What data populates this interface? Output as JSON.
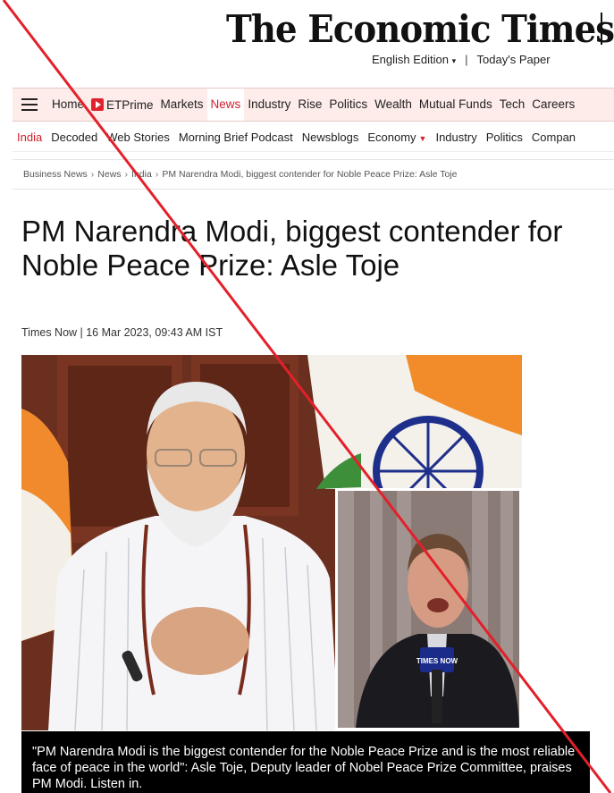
{
  "masthead": {
    "logo": "The Economic Times",
    "edition": "English Edition",
    "todays_paper": "Today's Paper"
  },
  "primary_nav": {
    "items": [
      "Home",
      "ETPrime",
      "Markets",
      "News",
      "Industry",
      "Rise",
      "Politics",
      "Wealth",
      "Mutual Funds",
      "Tech",
      "Careers"
    ],
    "active": "News"
  },
  "secondary_nav": {
    "items": [
      "India",
      "Decoded",
      "Web Stories",
      "Morning Brief Podcast",
      "Newsblogs",
      "Economy",
      "Industry",
      "Politics",
      "Compan"
    ],
    "active": "India"
  },
  "breadcrumb": [
    "Business News",
    "News",
    "India",
    "PM Narendra Modi, biggest contender for Noble Peace Prize: Asle Toje"
  ],
  "article": {
    "headline": "PM Narendra Modi, biggest contender for Noble Peace Prize: Asle Toje",
    "byline": "Times Now | 16 Mar 2023, 09:43 AM IST",
    "caption": "\"PM Narendra Modi is the biggest contender for the Noble Peace Prize and is the most reliable face of peace in the world\": Asle Toje, Deputy leader of Nobel Peace Prize Committee, praises PM Modi. Listen in.",
    "mic_logo": "TIMES NOW"
  },
  "colors": {
    "accent": "#d01f2d",
    "nav_bg": "#fdecea",
    "strike": "#e3202a"
  }
}
